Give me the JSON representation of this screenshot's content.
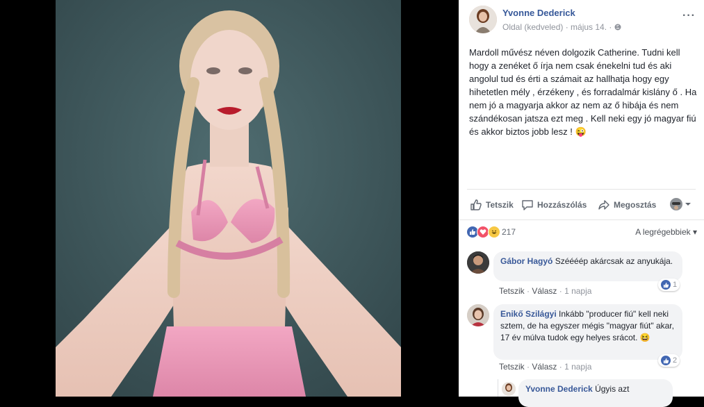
{
  "post": {
    "author": "Yvonne Dederick",
    "meta": "Oldal (kedveled) · május 14. ·",
    "text": "Mardoll művész néven dolgozik Catherine. Tudni kell hogy a zenéket ő írja nem csak énekelni tud és aki angolul tud és érti a számait az hallhatja hogy egy hihetetlen mély , érzékeny , és forradalmár kislány ő . Ha nem jó a magyarja akkor az nem az ő hibája és nem szándékosan jatsza ezt meg . Kell neki egy jó magyar fiú és akkor biztos jobb lesz ! 😜"
  },
  "actions": {
    "like": "Tetszik",
    "comment": "Hozzászólás",
    "share": "Megosztás"
  },
  "reactions": {
    "count": "217",
    "sort_label": "A legrégebbiek ▾"
  },
  "comments": [
    {
      "author": "Gábor Hagyó",
      "text": "Széééép akárcsak az anyukája.",
      "like_link": "Tetszik",
      "reply_link": "Válasz",
      "time": "1 napja",
      "likes": "1"
    },
    {
      "author": "Enikő Szilágyi",
      "text": "Inkább \"producer fiú\" kell neki sztem, de ha egyszer mégis \"magyar fiút\" akar, 17 év múlva tudok egy helyes srácot. 😆",
      "like_link": "Tetszik",
      "reply_link": "Válasz",
      "time": "1 napja",
      "likes": "2"
    },
    {
      "author": "Yvonne Dederick",
      "text": "Úgyis azt"
    }
  ],
  "colors": {
    "link_blue": "#365899",
    "like_blue": "#4267b2",
    "photo_background": "#3d575c"
  }
}
